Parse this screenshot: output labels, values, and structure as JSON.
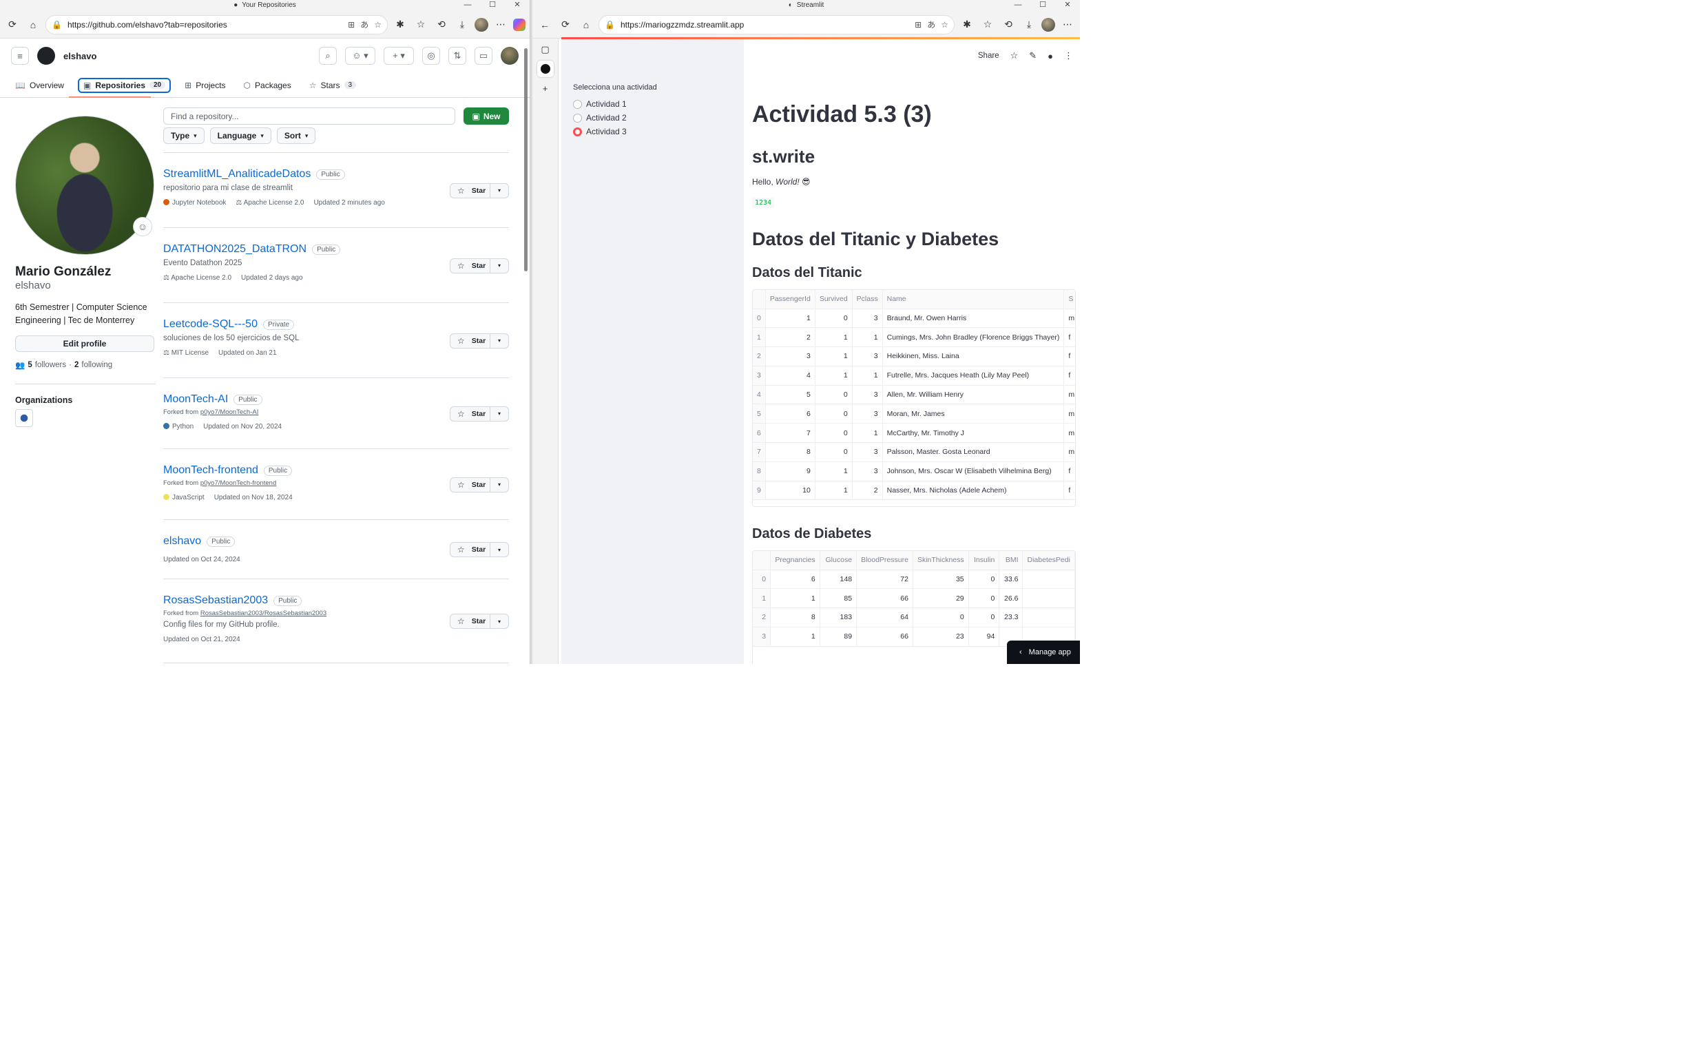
{
  "left_browser": {
    "window_title": "Your Repositories",
    "url": "https://github.com/elshavo?tab=repositories"
  },
  "github": {
    "username": "elshavo",
    "tabs": [
      {
        "label": "Overview",
        "icon": "book-icon",
        "count": null
      },
      {
        "label": "Repositories",
        "icon": "repo-icon",
        "count": "20"
      },
      {
        "label": "Projects",
        "icon": "table-icon",
        "count": null
      },
      {
        "label": "Packages",
        "icon": "package-icon",
        "count": null
      },
      {
        "label": "Stars",
        "icon": "star-icon",
        "count": "3"
      }
    ],
    "profile": {
      "name": "Mario González",
      "login": "elshavo",
      "bio": "6th Semestrer | Computer Science Engineering | Tec de Monterrey",
      "edit_label": "Edit profile",
      "followers": "5",
      "followers_label": "followers",
      "following": "2",
      "following_label": "following",
      "orgs_title": "Organizations"
    },
    "search_placeholder": "Find a repository...",
    "new_label": "New",
    "filters": [
      "Type",
      "Language",
      "Sort"
    ],
    "star_label": "Star",
    "repos": [
      {
        "name": "StreamlitML_AnaliticadeDatos",
        "visibility": "Public",
        "description": "repositorio para mi clase de streamlit",
        "forked_from": "",
        "language": "Jupyter Notebook",
        "lang_color": "#DA5B0B",
        "license": "Apache License 2.0",
        "updated": "Updated 2 minutes ago"
      },
      {
        "name": "DATATHON2025_DataTRON",
        "visibility": "Public",
        "description": "Evento Datathon 2025",
        "forked_from": "",
        "language": "",
        "lang_color": "",
        "license": "Apache License 2.0",
        "updated": "Updated 2 days ago"
      },
      {
        "name": "Leetcode-SQL---50",
        "visibility": "Private",
        "description": "soluciones de los 50 ejercicios de SQL",
        "forked_from": "",
        "language": "",
        "lang_color": "",
        "license": "MIT License",
        "updated": "Updated on Jan 21"
      },
      {
        "name": "MoonTech-AI",
        "visibility": "Public",
        "description": "",
        "forked_from": "p0yo7/MoonTech-AI",
        "language": "Python",
        "lang_color": "#3572A5",
        "license": "",
        "updated": "Updated on Nov 20, 2024"
      },
      {
        "name": "MoonTech-frontend",
        "visibility": "Public",
        "description": "",
        "forked_from": "p0yo7/MoonTech-frontend",
        "language": "JavaScript",
        "lang_color": "#f1e05a",
        "license": "",
        "updated": "Updated on Nov 18, 2024"
      },
      {
        "name": "elshavo",
        "visibility": "Public",
        "description": "",
        "forked_from": "",
        "language": "",
        "lang_color": "",
        "license": "",
        "updated": "Updated on Oct 24, 2024"
      },
      {
        "name": "RosasSebastian2003",
        "visibility": "Public",
        "description": "Config files for my GitHub profile.",
        "forked_from": "RosasSebastian2003/RosasSebastian2003",
        "language": "",
        "lang_color": "",
        "license": "",
        "updated": "Updated on Oct 21, 2024"
      }
    ],
    "forked_prefix": "Forked from"
  },
  "right_browser": {
    "window_title": "Streamlit",
    "url": "https://mariogzzmdz.streamlit.app"
  },
  "streamlit": {
    "radio_label": "Selecciona una actividad",
    "options": [
      "Actividad 1",
      "Actividad 2",
      "Actividad 3"
    ],
    "selected_index": 2,
    "toolbar": {
      "share": "Share"
    },
    "title": "Actividad 5.3 (3)",
    "subtitle": "st.write",
    "hello_prefix": "Hello, ",
    "hello_em": "World!",
    "hello_emoji": "😎",
    "number": "1234",
    "section_title": "Datos del Titanic y Diabetes",
    "titanic_title": "Datos del Titanic",
    "titanic_columns": [
      "",
      "PassengerId",
      "Survived",
      "Pclass",
      "Name",
      "S"
    ],
    "titanic_rows": [
      [
        "0",
        "1",
        "0",
        "3",
        "Braund, Mr. Owen Harris",
        "m"
      ],
      [
        "1",
        "2",
        "1",
        "1",
        "Cumings, Mrs. John Bradley (Florence Briggs Thayer)",
        "f"
      ],
      [
        "2",
        "3",
        "1",
        "3",
        "Heikkinen, Miss. Laina",
        "f"
      ],
      [
        "3",
        "4",
        "1",
        "1",
        "Futrelle, Mrs. Jacques Heath (Lily May Peel)",
        "f"
      ],
      [
        "4",
        "5",
        "0",
        "3",
        "Allen, Mr. William Henry",
        "m"
      ],
      [
        "5",
        "6",
        "0",
        "3",
        "Moran, Mr. James",
        "m"
      ],
      [
        "6",
        "7",
        "0",
        "1",
        "McCarthy, Mr. Timothy J",
        "m"
      ],
      [
        "7",
        "8",
        "0",
        "3",
        "Palsson, Master. Gosta Leonard",
        "m"
      ],
      [
        "8",
        "9",
        "1",
        "3",
        "Johnson, Mrs. Oscar W (Elisabeth Vilhelmina Berg)",
        "f"
      ],
      [
        "9",
        "10",
        "1",
        "2",
        "Nasser, Mrs. Nicholas (Adele Achem)",
        "f"
      ]
    ],
    "diabetes_title": "Datos de Diabetes",
    "diabetes_columns": [
      "",
      "Pregnancies",
      "Glucose",
      "BloodPressure",
      "SkinThickness",
      "Insulin",
      "BMI",
      "DiabetesPedi"
    ],
    "diabetes_rows": [
      [
        "0",
        "6",
        "148",
        "72",
        "35",
        "0",
        "33.6",
        ""
      ],
      [
        "1",
        "1",
        "85",
        "66",
        "29",
        "0",
        "26.6",
        ""
      ],
      [
        "2",
        "8",
        "183",
        "64",
        "0",
        "0",
        "23.3",
        ""
      ],
      [
        "3",
        "1",
        "89",
        "66",
        "23",
        "94",
        "",
        ""
      ]
    ],
    "manage_label": "Manage app"
  }
}
